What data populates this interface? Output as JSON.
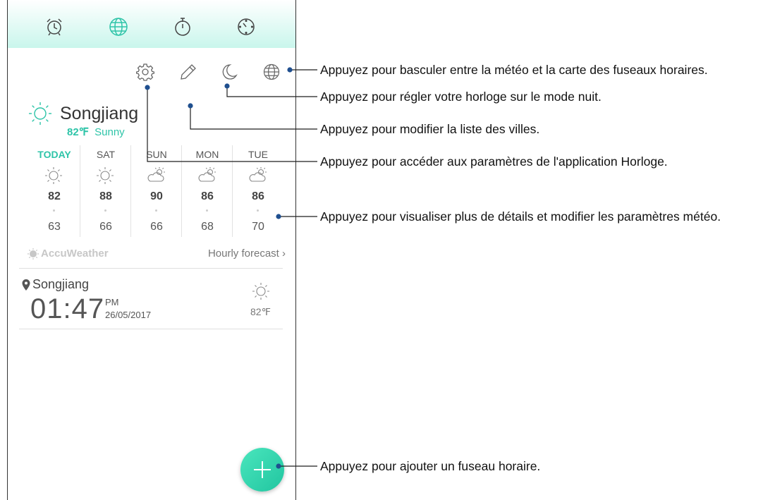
{
  "app": {
    "tabs": [
      {
        "label": "Alarm",
        "icon": "alarm-clock-icon"
      },
      {
        "label": "World Clock",
        "icon": "globe-icon",
        "active": true
      },
      {
        "label": "Stopwatch",
        "icon": "stopwatch-icon"
      },
      {
        "label": "Timer",
        "icon": "timer-icon"
      }
    ],
    "toolbar": [
      "gear-icon",
      "pencil-icon",
      "moon-icon",
      "globe-icon"
    ]
  },
  "weather": {
    "city": "Songjiang",
    "current_temp": "82℉",
    "condition": "Sunny",
    "forecast": [
      {
        "day": "TODAY",
        "icon": "sun-icon",
        "high": "82",
        "low": "63"
      },
      {
        "day": "SAT",
        "icon": "sun-icon",
        "high": "88",
        "low": "66"
      },
      {
        "day": "SUN",
        "icon": "partly-cloudy-icon",
        "high": "90",
        "low": "66"
      },
      {
        "day": "MON",
        "icon": "partly-cloudy-icon",
        "high": "86",
        "low": "68"
      },
      {
        "day": "TUE",
        "icon": "partly-cloudy-icon",
        "high": "86",
        "low": "70"
      }
    ],
    "provider": "AccuWeather",
    "hourly_link": "Hourly forecast ›"
  },
  "world_clock": {
    "city": "Songjiang",
    "time": "01:47",
    "ampm": "PM",
    "date": "26/05/2017",
    "temp": "82℉"
  },
  "colors": {
    "accent": "#2ec4a8",
    "header_gradient_end": "#c9f6ec",
    "callout_blue": "#1f4f8f"
  },
  "annotations": [
    "Appuyez pour basculer entre la météo et la carte des fuseaux horaires.",
    "Appuyez pour régler votre horloge sur le mode nuit.",
    "Appuyez pour modifier la liste des villes.",
    "Appuyez pour accéder aux paramètres de l'application Horloge.",
    "Appuyez pour visualiser plus de détails et modifier les paramètres météo.",
    "Appuyez pour ajouter un fuseau horaire."
  ]
}
